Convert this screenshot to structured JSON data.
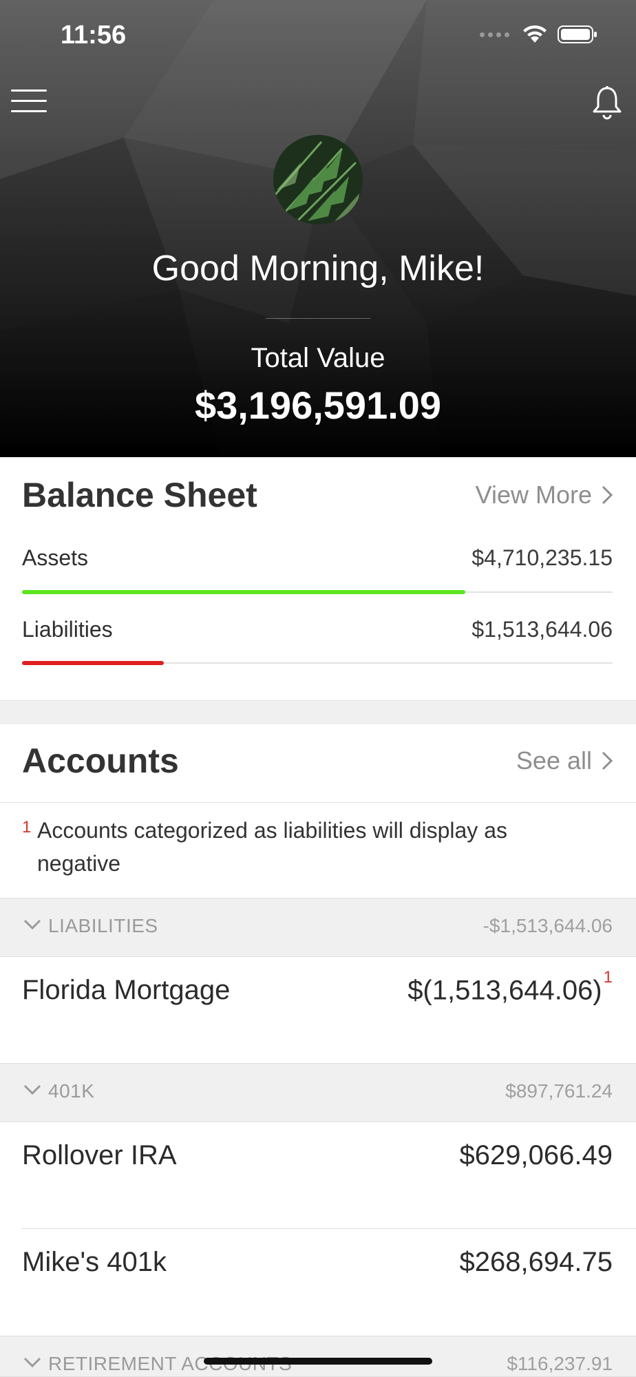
{
  "status_bar": {
    "time": "11:56"
  },
  "header": {
    "greeting": "Good Morning, Mike!",
    "total_label": "Total Value",
    "total_value": "$3,196,591.09"
  },
  "balance_sheet": {
    "title": "Balance Sheet",
    "link_label": "View More",
    "rows": [
      {
        "label": "Assets",
        "value": "$4,710,235.15",
        "fill_percent": 75,
        "color": "#5ce51f"
      },
      {
        "label": "Liabilities",
        "value": "$1,513,644.06",
        "fill_percent": 24,
        "color": "#e02020"
      }
    ]
  },
  "accounts": {
    "title": "Accounts",
    "link_label": "See all",
    "note_marker": "1",
    "note": "Accounts categorized as liabilities will display as negative",
    "groups": [
      {
        "name": "LIABILITIES",
        "total": "-$1,513,644.06",
        "items": [
          {
            "name": "Florida Mortgage",
            "value": "$(1,513,644.06)",
            "marker": "1"
          }
        ]
      },
      {
        "name": "401K",
        "total": "$897,761.24",
        "items": [
          {
            "name": "Rollover IRA",
            "value": "$629,066.49"
          },
          {
            "name": "Mike's 401k",
            "value": "$268,694.75"
          }
        ]
      },
      {
        "name": "RETIREMENT ACCOUNTS",
        "total": "$116,237.91",
        "items": []
      }
    ]
  },
  "colors": {
    "accent_red": "#d9342b",
    "asset_green": "#5ce51f",
    "liability_red": "#e02020"
  },
  "icons": [
    "menu-icon",
    "bell-icon",
    "wifi-icon",
    "battery-icon",
    "chevron-right-icon",
    "chevron-down-icon"
  ]
}
